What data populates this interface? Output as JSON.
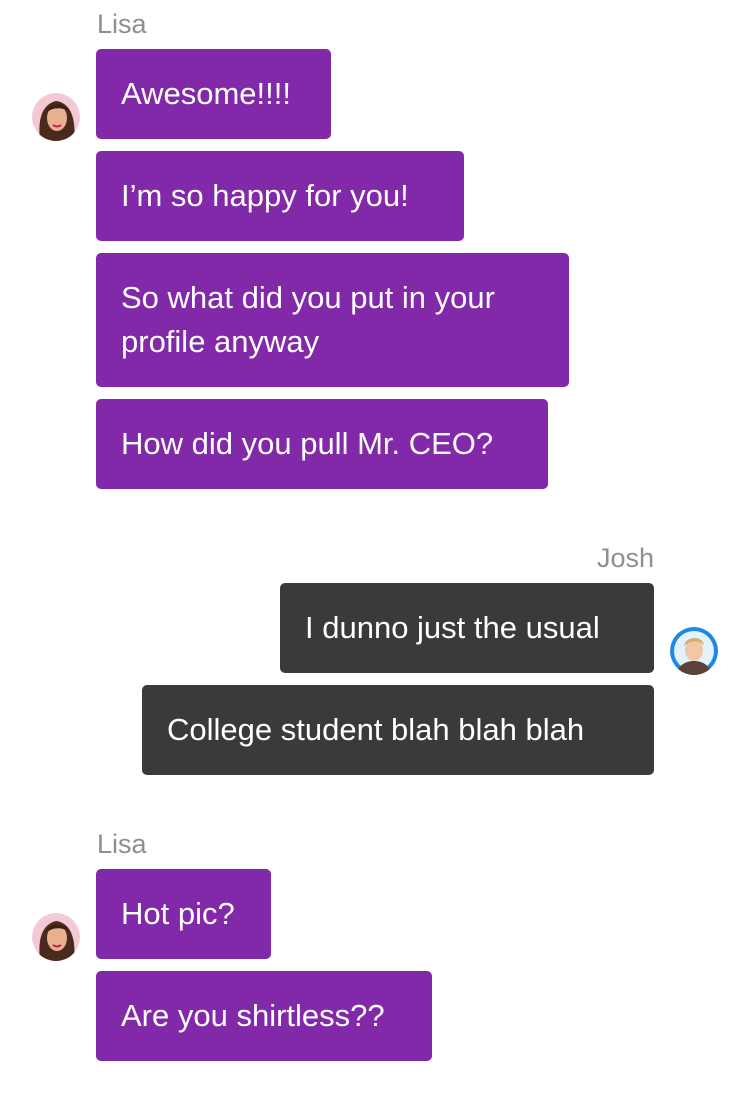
{
  "groups": [
    {
      "sender": "Lisa",
      "messages": [
        "Awesome!!!!",
        "I’m so happy for you!",
        "So what did you put in your profile anyway",
        "How did you pull Mr. CEO?"
      ],
      "avatar_icon": "lisa-avatar-icon",
      "bubble_color": "#8129a8"
    },
    {
      "sender": "Josh",
      "messages": [
        "I dunno just the usual",
        "College student blah blah blah"
      ],
      "avatar_icon": "josh-avatar-icon",
      "bubble_color": "#3a3a3a"
    },
    {
      "sender": "Lisa",
      "messages": [
        "Hot pic?",
        "Are you shirtless??"
      ],
      "avatar_icon": "lisa-avatar-icon",
      "bubble_color": "#8129a8"
    }
  ]
}
